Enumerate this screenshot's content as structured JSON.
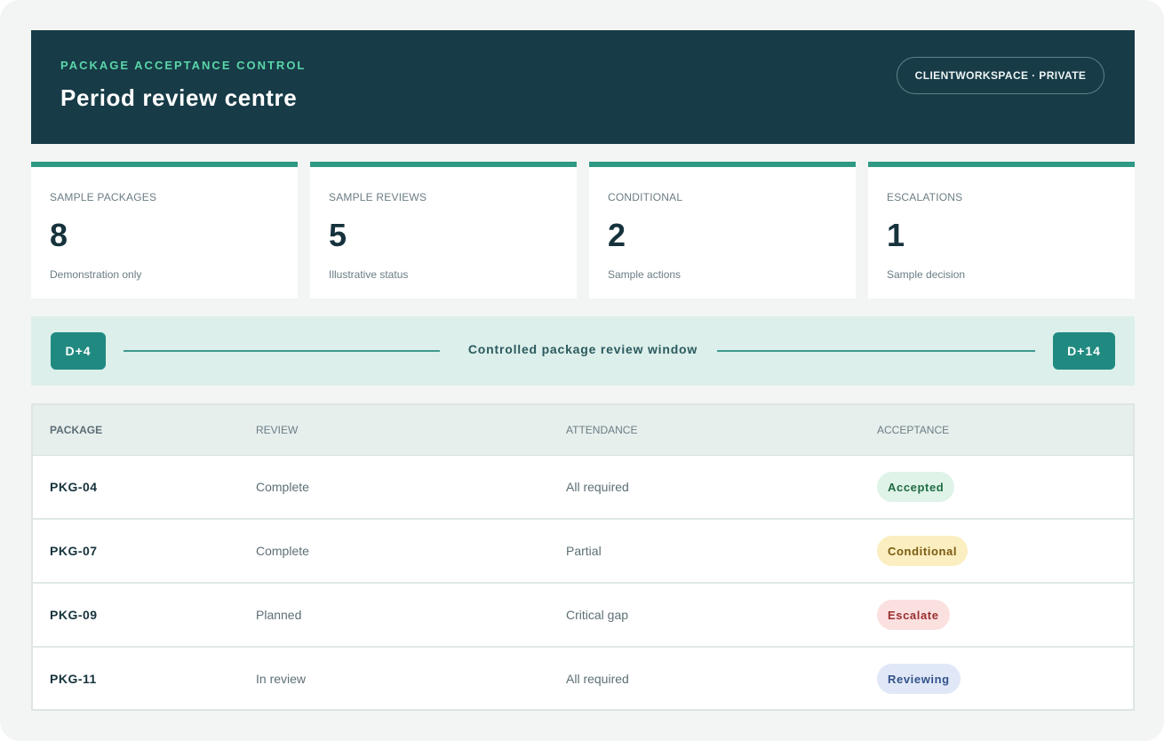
{
  "hero": {
    "kicker": "PACKAGE ACCEPTANCE CONTROL",
    "title": "Period review centre",
    "badge": "CLIENTWORKSPACE · PRIVATE"
  },
  "stats": [
    {
      "label": "SAMPLE PACKAGES",
      "value": "8",
      "note": "Demonstration only"
    },
    {
      "label": "SAMPLE REVIEWS",
      "value": "5",
      "note": "Illustrative status"
    },
    {
      "label": "CONDITIONAL",
      "value": "2",
      "note": "Sample actions"
    },
    {
      "label": "ESCALATIONS",
      "value": "1",
      "note": "Sample decision"
    }
  ],
  "window": {
    "start": "D+4",
    "label": "Controlled package review window",
    "end": "D+14"
  },
  "table": {
    "headers": [
      "PACKAGE",
      "REVIEW",
      "ATTENDANCE",
      "ACCEPTANCE"
    ],
    "rows": [
      {
        "package": "PKG-04",
        "review": "Complete",
        "attendance": "All required",
        "acceptance": "Accepted"
      },
      {
        "package": "PKG-07",
        "review": "Complete",
        "attendance": "Partial",
        "acceptance": "Conditional"
      },
      {
        "package": "PKG-09",
        "review": "Planned",
        "attendance": "Critical gap",
        "acceptance": "Escalate"
      },
      {
        "package": "PKG-11",
        "review": "In review",
        "attendance": "All required",
        "acceptance": "Reviewing"
      }
    ]
  },
  "colors": {
    "hero_bg": "#173b47",
    "accent": "#2f9a84",
    "accepted_bg": "#dff3e8",
    "accepted_fg": "#1f6b45",
    "conditional_bg": "#fbeec0",
    "conditional_fg": "#7a5a10",
    "escalate_bg": "#fbe0e0",
    "escalate_fg": "#9a2f2f",
    "reviewing_bg": "#e0e8f7",
    "reviewing_fg": "#33528a"
  }
}
